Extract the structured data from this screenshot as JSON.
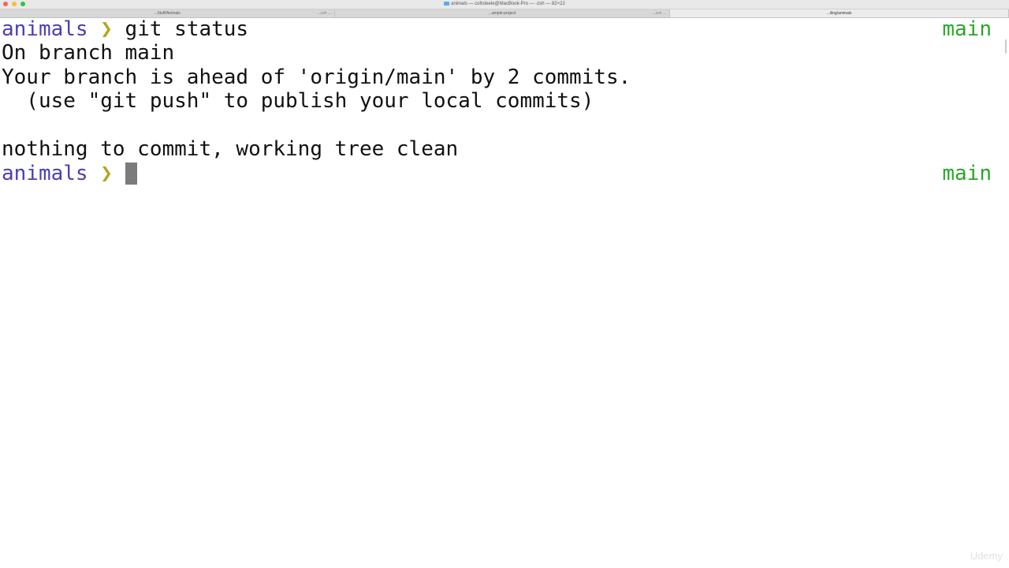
{
  "window": {
    "title": "animals — coltsteele@MacBook-Pro — -zsh — 82×22"
  },
  "tabs": [
    {
      "label": "...Stuff/Animals",
      "sub": "",
      "active": false
    },
    {
      "label": "",
      "sub": "...zsh ...",
      "active": false
    },
    {
      "label": "...ample-project",
      "sub": "...zsh ...",
      "active": false
    },
    {
      "label": "...iling/animals",
      "sub": "",
      "active": true
    }
  ],
  "terminal": {
    "prompt_dir": "animals",
    "prompt_symbol": "❯",
    "branch": "main",
    "command": "git status",
    "output": [
      "On branch main",
      "Your branch is ahead of 'origin/main' by 2 commits.",
      "  (use \"git push\" to publish your local commits)",
      "",
      "nothing to commit, working tree clean"
    ]
  },
  "watermark": "Udemy",
  "colors": {
    "prompt_dir": "#4a3fb3",
    "prompt_symbol": "#b6a51f",
    "branch": "#2aa52a",
    "cursor": "#7b7b7b"
  }
}
